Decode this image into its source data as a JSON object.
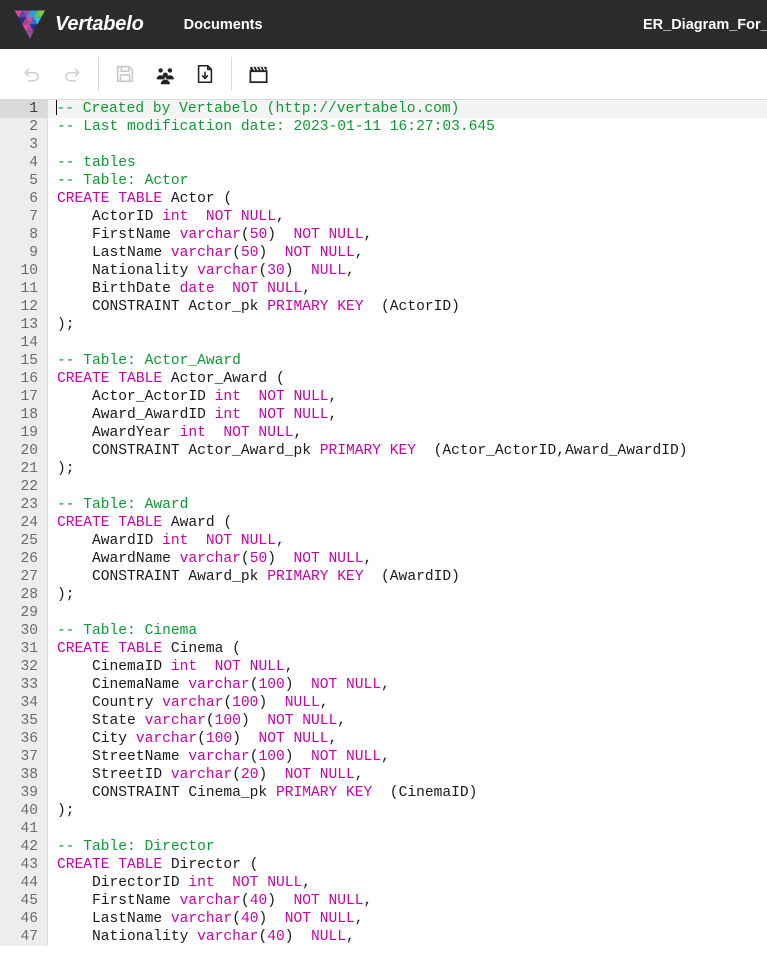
{
  "header": {
    "brand": "Vertabelo",
    "brand_icon": "vertabelo-logo-icon",
    "nav": [
      {
        "label": "Documents",
        "name": "nav-documents"
      }
    ],
    "document_title": "ER_Diagram_For_a",
    "background_color": "#2b2b2b"
  },
  "toolbar": {
    "items": [
      {
        "name": "undo-button",
        "icon": "undo-icon",
        "label": "Undo",
        "disabled": true
      },
      {
        "name": "redo-button",
        "icon": "redo-icon",
        "label": "Redo",
        "disabled": true
      },
      {
        "name": "save-button",
        "icon": "save-icon",
        "label": "Save",
        "disabled": true
      },
      {
        "name": "share-button",
        "icon": "people-icon",
        "label": "Share",
        "disabled": false
      },
      {
        "name": "download-button",
        "icon": "download-icon",
        "label": "Download SQL",
        "disabled": false
      },
      {
        "name": "model-button",
        "icon": "clapper-icon",
        "label": "Model",
        "disabled": false
      }
    ]
  },
  "editor": {
    "cursor_line": 1,
    "colors": {
      "comment": "#0b9b32",
      "keyword": "#cc00a6",
      "identifier": "#1a1a1a",
      "gutter_bg": "#ededed",
      "active_line_bg": "#f4f4f4"
    },
    "lines": [
      {
        "n": 1,
        "tokens": [
          {
            "t": "caret",
            "v": ""
          },
          {
            "t": "cm",
            "v": "-- Created by Vertabelo (http://vertabelo.com)"
          }
        ]
      },
      {
        "n": 2,
        "tokens": [
          {
            "t": "cm",
            "v": "-- Last modification date: 2023-01-11 16:27:03.645"
          }
        ]
      },
      {
        "n": 3,
        "tokens": []
      },
      {
        "n": 4,
        "tokens": [
          {
            "t": "cm",
            "v": "-- tables"
          }
        ]
      },
      {
        "n": 5,
        "tokens": [
          {
            "t": "cm",
            "v": "-- Table: Actor"
          }
        ]
      },
      {
        "n": 6,
        "tokens": [
          {
            "t": "kw",
            "v": "CREATE TABLE"
          },
          {
            "t": "id",
            "v": " Actor ("
          }
        ]
      },
      {
        "n": 7,
        "tokens": [
          {
            "t": "id",
            "v": "    ActorID "
          },
          {
            "t": "kw",
            "v": "int"
          },
          {
            "t": "id",
            "v": "  "
          },
          {
            "t": "kw",
            "v": "NOT NULL"
          },
          {
            "t": "id",
            "v": ","
          }
        ]
      },
      {
        "n": 8,
        "tokens": [
          {
            "t": "id",
            "v": "    FirstName "
          },
          {
            "t": "kw",
            "v": "varchar"
          },
          {
            "t": "id",
            "v": "("
          },
          {
            "t": "kw",
            "v": "50"
          },
          {
            "t": "id",
            "v": ")  "
          },
          {
            "t": "kw",
            "v": "NOT NULL"
          },
          {
            "t": "id",
            "v": ","
          }
        ]
      },
      {
        "n": 9,
        "tokens": [
          {
            "t": "id",
            "v": "    LastName "
          },
          {
            "t": "kw",
            "v": "varchar"
          },
          {
            "t": "id",
            "v": "("
          },
          {
            "t": "kw",
            "v": "50"
          },
          {
            "t": "id",
            "v": ")  "
          },
          {
            "t": "kw",
            "v": "NOT NULL"
          },
          {
            "t": "id",
            "v": ","
          }
        ]
      },
      {
        "n": 10,
        "tokens": [
          {
            "t": "id",
            "v": "    Nationality "
          },
          {
            "t": "kw",
            "v": "varchar"
          },
          {
            "t": "id",
            "v": "("
          },
          {
            "t": "kw",
            "v": "30"
          },
          {
            "t": "id",
            "v": ")  "
          },
          {
            "t": "kw",
            "v": "NULL"
          },
          {
            "t": "id",
            "v": ","
          }
        ]
      },
      {
        "n": 11,
        "tokens": [
          {
            "t": "id",
            "v": "    BirthDate "
          },
          {
            "t": "kw",
            "v": "date"
          },
          {
            "t": "id",
            "v": "  "
          },
          {
            "t": "kw",
            "v": "NOT NULL"
          },
          {
            "t": "id",
            "v": ","
          }
        ]
      },
      {
        "n": 12,
        "tokens": [
          {
            "t": "id",
            "v": "    CONSTRAINT Actor_pk "
          },
          {
            "t": "kw",
            "v": "PRIMARY KEY"
          },
          {
            "t": "id",
            "v": "  (ActorID)"
          }
        ]
      },
      {
        "n": 13,
        "tokens": [
          {
            "t": "id",
            "v": ");"
          }
        ]
      },
      {
        "n": 14,
        "tokens": []
      },
      {
        "n": 15,
        "tokens": [
          {
            "t": "cm",
            "v": "-- Table: Actor_Award"
          }
        ]
      },
      {
        "n": 16,
        "tokens": [
          {
            "t": "kw",
            "v": "CREATE TABLE"
          },
          {
            "t": "id",
            "v": " Actor_Award ("
          }
        ]
      },
      {
        "n": 17,
        "tokens": [
          {
            "t": "id",
            "v": "    Actor_ActorID "
          },
          {
            "t": "kw",
            "v": "int"
          },
          {
            "t": "id",
            "v": "  "
          },
          {
            "t": "kw",
            "v": "NOT NULL"
          },
          {
            "t": "id",
            "v": ","
          }
        ]
      },
      {
        "n": 18,
        "tokens": [
          {
            "t": "id",
            "v": "    Award_AwardID "
          },
          {
            "t": "kw",
            "v": "int"
          },
          {
            "t": "id",
            "v": "  "
          },
          {
            "t": "kw",
            "v": "NOT NULL"
          },
          {
            "t": "id",
            "v": ","
          }
        ]
      },
      {
        "n": 19,
        "tokens": [
          {
            "t": "id",
            "v": "    AwardYear "
          },
          {
            "t": "kw",
            "v": "int"
          },
          {
            "t": "id",
            "v": "  "
          },
          {
            "t": "kw",
            "v": "NOT NULL"
          },
          {
            "t": "id",
            "v": ","
          }
        ]
      },
      {
        "n": 20,
        "tokens": [
          {
            "t": "id",
            "v": "    CONSTRAINT Actor_Award_pk "
          },
          {
            "t": "kw",
            "v": "PRIMARY KEY"
          },
          {
            "t": "id",
            "v": "  (Actor_ActorID,Award_AwardID)"
          }
        ]
      },
      {
        "n": 21,
        "tokens": [
          {
            "t": "id",
            "v": ");"
          }
        ]
      },
      {
        "n": 22,
        "tokens": []
      },
      {
        "n": 23,
        "tokens": [
          {
            "t": "cm",
            "v": "-- Table: Award"
          }
        ]
      },
      {
        "n": 24,
        "tokens": [
          {
            "t": "kw",
            "v": "CREATE TABLE"
          },
          {
            "t": "id",
            "v": " Award ("
          }
        ]
      },
      {
        "n": 25,
        "tokens": [
          {
            "t": "id",
            "v": "    AwardID "
          },
          {
            "t": "kw",
            "v": "int"
          },
          {
            "t": "id",
            "v": "  "
          },
          {
            "t": "kw",
            "v": "NOT NULL"
          },
          {
            "t": "id",
            "v": ","
          }
        ]
      },
      {
        "n": 26,
        "tokens": [
          {
            "t": "id",
            "v": "    AwardName "
          },
          {
            "t": "kw",
            "v": "varchar"
          },
          {
            "t": "id",
            "v": "("
          },
          {
            "t": "kw",
            "v": "50"
          },
          {
            "t": "id",
            "v": ")  "
          },
          {
            "t": "kw",
            "v": "NOT NULL"
          },
          {
            "t": "id",
            "v": ","
          }
        ]
      },
      {
        "n": 27,
        "tokens": [
          {
            "t": "id",
            "v": "    CONSTRAINT Award_pk "
          },
          {
            "t": "kw",
            "v": "PRIMARY KEY"
          },
          {
            "t": "id",
            "v": "  (AwardID)"
          }
        ]
      },
      {
        "n": 28,
        "tokens": [
          {
            "t": "id",
            "v": ");"
          }
        ]
      },
      {
        "n": 29,
        "tokens": []
      },
      {
        "n": 30,
        "tokens": [
          {
            "t": "cm",
            "v": "-- Table: Cinema"
          }
        ]
      },
      {
        "n": 31,
        "tokens": [
          {
            "t": "kw",
            "v": "CREATE TABLE"
          },
          {
            "t": "id",
            "v": " Cinema ("
          }
        ]
      },
      {
        "n": 32,
        "tokens": [
          {
            "t": "id",
            "v": "    CinemaID "
          },
          {
            "t": "kw",
            "v": "int"
          },
          {
            "t": "id",
            "v": "  "
          },
          {
            "t": "kw",
            "v": "NOT NULL"
          },
          {
            "t": "id",
            "v": ","
          }
        ]
      },
      {
        "n": 33,
        "tokens": [
          {
            "t": "id",
            "v": "    CinemaName "
          },
          {
            "t": "kw",
            "v": "varchar"
          },
          {
            "t": "id",
            "v": "("
          },
          {
            "t": "kw",
            "v": "100"
          },
          {
            "t": "id",
            "v": ")  "
          },
          {
            "t": "kw",
            "v": "NOT NULL"
          },
          {
            "t": "id",
            "v": ","
          }
        ]
      },
      {
        "n": 34,
        "tokens": [
          {
            "t": "id",
            "v": "    Country "
          },
          {
            "t": "kw",
            "v": "varchar"
          },
          {
            "t": "id",
            "v": "("
          },
          {
            "t": "kw",
            "v": "100"
          },
          {
            "t": "id",
            "v": ")  "
          },
          {
            "t": "kw",
            "v": "NULL"
          },
          {
            "t": "id",
            "v": ","
          }
        ]
      },
      {
        "n": 35,
        "tokens": [
          {
            "t": "id",
            "v": "    State "
          },
          {
            "t": "kw",
            "v": "varchar"
          },
          {
            "t": "id",
            "v": "("
          },
          {
            "t": "kw",
            "v": "100"
          },
          {
            "t": "id",
            "v": ")  "
          },
          {
            "t": "kw",
            "v": "NOT NULL"
          },
          {
            "t": "id",
            "v": ","
          }
        ]
      },
      {
        "n": 36,
        "tokens": [
          {
            "t": "id",
            "v": "    City "
          },
          {
            "t": "kw",
            "v": "varchar"
          },
          {
            "t": "id",
            "v": "("
          },
          {
            "t": "kw",
            "v": "100"
          },
          {
            "t": "id",
            "v": ")  "
          },
          {
            "t": "kw",
            "v": "NOT NULL"
          },
          {
            "t": "id",
            "v": ","
          }
        ]
      },
      {
        "n": 37,
        "tokens": [
          {
            "t": "id",
            "v": "    StreetName "
          },
          {
            "t": "kw",
            "v": "varchar"
          },
          {
            "t": "id",
            "v": "("
          },
          {
            "t": "kw",
            "v": "100"
          },
          {
            "t": "id",
            "v": ")  "
          },
          {
            "t": "kw",
            "v": "NOT NULL"
          },
          {
            "t": "id",
            "v": ","
          }
        ]
      },
      {
        "n": 38,
        "tokens": [
          {
            "t": "id",
            "v": "    StreetID "
          },
          {
            "t": "kw",
            "v": "varchar"
          },
          {
            "t": "id",
            "v": "("
          },
          {
            "t": "kw",
            "v": "20"
          },
          {
            "t": "id",
            "v": ")  "
          },
          {
            "t": "kw",
            "v": "NOT NULL"
          },
          {
            "t": "id",
            "v": ","
          }
        ]
      },
      {
        "n": 39,
        "tokens": [
          {
            "t": "id",
            "v": "    CONSTRAINT Cinema_pk "
          },
          {
            "t": "kw",
            "v": "PRIMARY KEY"
          },
          {
            "t": "id",
            "v": "  (CinemaID)"
          }
        ]
      },
      {
        "n": 40,
        "tokens": [
          {
            "t": "id",
            "v": ");"
          }
        ]
      },
      {
        "n": 41,
        "tokens": []
      },
      {
        "n": 42,
        "tokens": [
          {
            "t": "cm",
            "v": "-- Table: Director"
          }
        ]
      },
      {
        "n": 43,
        "tokens": [
          {
            "t": "kw",
            "v": "CREATE TABLE"
          },
          {
            "t": "id",
            "v": " Director ("
          }
        ]
      },
      {
        "n": 44,
        "tokens": [
          {
            "t": "id",
            "v": "    DirectorID "
          },
          {
            "t": "kw",
            "v": "int"
          },
          {
            "t": "id",
            "v": "  "
          },
          {
            "t": "kw",
            "v": "NOT NULL"
          },
          {
            "t": "id",
            "v": ","
          }
        ]
      },
      {
        "n": 45,
        "tokens": [
          {
            "t": "id",
            "v": "    FirstName "
          },
          {
            "t": "kw",
            "v": "varchar"
          },
          {
            "t": "id",
            "v": "("
          },
          {
            "t": "kw",
            "v": "40"
          },
          {
            "t": "id",
            "v": ")  "
          },
          {
            "t": "kw",
            "v": "NOT NULL"
          },
          {
            "t": "id",
            "v": ","
          }
        ]
      },
      {
        "n": 46,
        "tokens": [
          {
            "t": "id",
            "v": "    LastName "
          },
          {
            "t": "kw",
            "v": "varchar"
          },
          {
            "t": "id",
            "v": "("
          },
          {
            "t": "kw",
            "v": "40"
          },
          {
            "t": "id",
            "v": ")  "
          },
          {
            "t": "kw",
            "v": "NOT NULL"
          },
          {
            "t": "id",
            "v": ","
          }
        ]
      },
      {
        "n": 47,
        "tokens": [
          {
            "t": "id",
            "v": "    Nationality "
          },
          {
            "t": "kw",
            "v": "varchar"
          },
          {
            "t": "id",
            "v": "("
          },
          {
            "t": "kw",
            "v": "40"
          },
          {
            "t": "id",
            "v": ")  "
          },
          {
            "t": "kw",
            "v": "NULL"
          },
          {
            "t": "id",
            "v": ","
          }
        ]
      }
    ]
  }
}
